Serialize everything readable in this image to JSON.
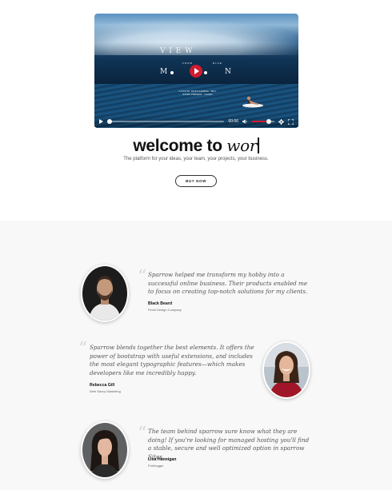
{
  "video": {
    "title_word1": "V I E W",
    "title_small_left": "FROM",
    "title_small_right": "BLUE",
    "title_word2_left": "M",
    "title_word2_right": "N",
    "credits": "A FILM BY JOHN FLEMING · WILL STARS PRESENT · CARRY",
    "time": "00:06"
  },
  "hero": {
    "title_static": "welcome to",
    "title_typed": "wor",
    "subtitle": "The platform for your ideas, your team, your projects, your business.",
    "button_label": "BUY NOW"
  },
  "testimonials": [
    {
      "quote": "Sparrow helped me transform my hobby into a successful online business. Their products enabled me to focus on creating top-notch solutions for my clients.",
      "name": "Black Beard",
      "company": "Pexel Design Company"
    },
    {
      "quote": "Sparrow blends together the best elements. It offers the power of bootstrap with useful extensions, and includes the most elegant typographic features—which makes developers like me incredibly happy.",
      "name": "Rebecca Gill",
      "company": "Web Savvy Marketing"
    },
    {
      "quote": "The team behind sparrow sure know what they are doing! If you're looking for managed hosting you'll find a stable, secure and well optimized option in sparrow Sites.",
      "name": "Lisa Hannigan",
      "company": "Problogger"
    }
  ],
  "icons": {
    "quote": "quote-icon",
    "play": "play-icon",
    "volume": "volume-icon",
    "settings": "gear-icon",
    "fullscreen": "fullscreen-icon"
  },
  "colors": {
    "accent": "#d11b2e",
    "section_bg": "#f8f8f8"
  },
  "player": {
    "progress": 0.02,
    "volume": 0.75
  }
}
